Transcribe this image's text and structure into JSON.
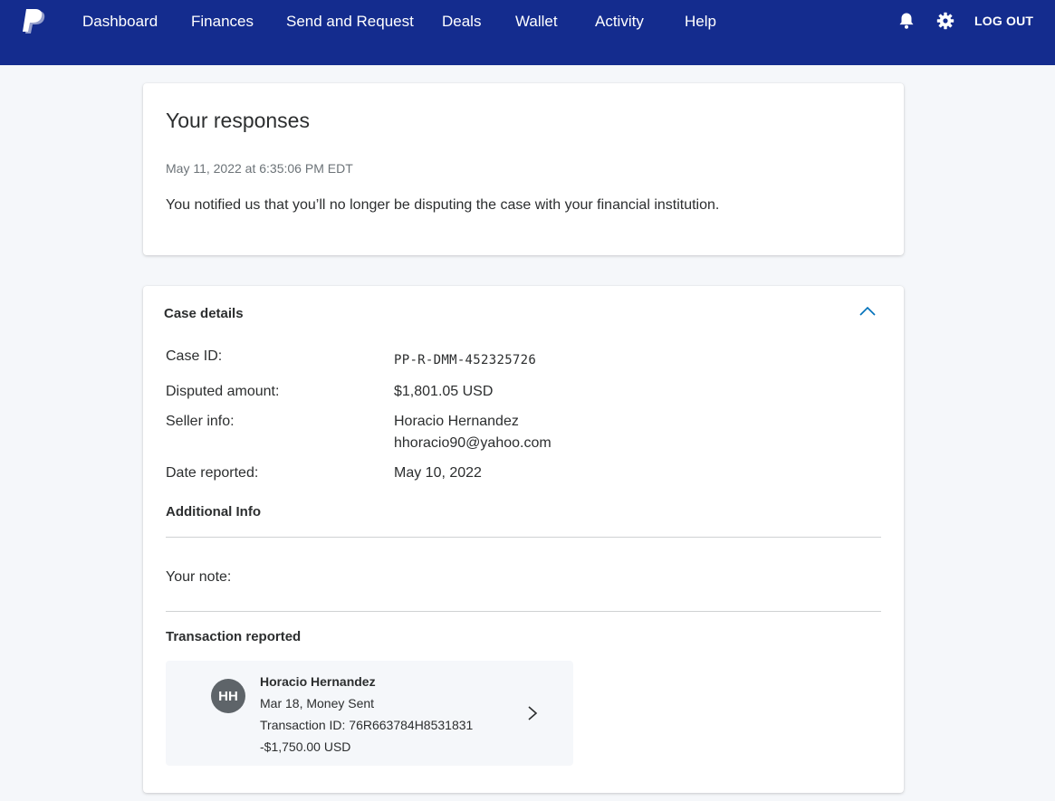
{
  "nav": {
    "items": [
      "Dashboard",
      "Finances",
      "Send and Request",
      "Deals",
      "Wallet",
      "Activity",
      "Help"
    ],
    "logout_label": "LOG OUT",
    "icons": [
      "paypal-logo",
      "bell-icon",
      "gear-icon"
    ]
  },
  "responses": {
    "title": "Your responses",
    "timestamp": "May 11, 2022 at 6:35:06 PM EDT",
    "message": "You notified us that you’ll no longer be disputing the case with your financial institution."
  },
  "case_details": {
    "title": "Case details",
    "case_id_label": "Case ID:",
    "case_id_value": "PP-R-DMM-452325726",
    "amount_label": "Disputed amount:",
    "amount_value": "$1,801.05 USD",
    "seller_label": "Seller info:",
    "seller_name": "Horacio Hernandez",
    "seller_email": "hhoracio90@yahoo.com",
    "date_label": "Date reported:",
    "date_value": "May 10, 2022",
    "additional_info_heading": "Additional Info",
    "note_label": "Your note:",
    "transaction_heading": "Transaction reported"
  },
  "transaction": {
    "initials": "HH",
    "name": "Horacio Hernandez",
    "subtitle": "Mar 18, Money Sent",
    "id_line": "Transaction ID: 76R663784H8531831",
    "amount": "-$1,750.00 USD"
  },
  "colors": {
    "nav_bg": "#142c8e",
    "page_bg": "#f5f7fa",
    "accent": "#0070ba",
    "avatar_bg": "#5e6469"
  }
}
